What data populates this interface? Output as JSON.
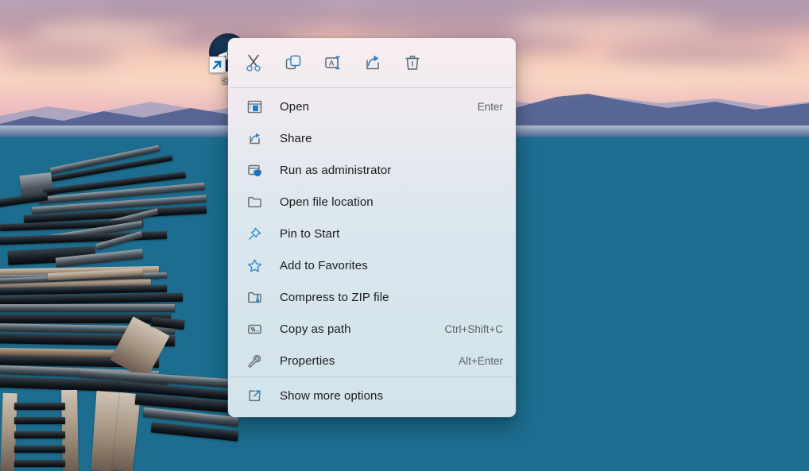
{
  "desktop": {
    "icon": {
      "label": "Ste",
      "full_name": "Steam",
      "art": "steam-disc-icon",
      "overlay": "shortcut-arrow-icon"
    },
    "wallpaper": {
      "description": "sunset lake with wooden pier",
      "sky_color": "#f0c0b4",
      "water_color": "#17749b",
      "mountain_color": "#5a6a93"
    }
  },
  "context_menu": {
    "toolbar": [
      {
        "name": "cut",
        "icon": "scissors-icon",
        "tooltip": "Cut"
      },
      {
        "name": "copy",
        "icon": "copy-icon",
        "tooltip": "Copy"
      },
      {
        "name": "rename",
        "icon": "rename-icon",
        "tooltip": "Rename"
      },
      {
        "name": "share",
        "icon": "share-icon",
        "tooltip": "Share"
      },
      {
        "name": "delete",
        "icon": "trash-icon",
        "tooltip": "Delete"
      }
    ],
    "items_top": [
      {
        "label": "Open",
        "shortcut": "Enter",
        "icon": "open-window-icon"
      },
      {
        "label": "Share",
        "shortcut": "",
        "icon": "share-box-icon"
      },
      {
        "label": "Run as administrator",
        "shortcut": "",
        "icon": "shield-window-icon"
      },
      {
        "label": "Open file location",
        "shortcut": "",
        "icon": "folder-icon"
      },
      {
        "label": "Pin to Start",
        "shortcut": "",
        "icon": "pin-icon"
      },
      {
        "label": "Add to Favorites",
        "shortcut": "",
        "icon": "star-icon"
      },
      {
        "label": "Compress to ZIP file",
        "shortcut": "",
        "icon": "zip-folder-icon"
      },
      {
        "label": "Copy as path",
        "shortcut": "Ctrl+Shift+C",
        "icon": "path-icon"
      },
      {
        "label": "Properties",
        "shortcut": "Alt+Enter",
        "icon": "wrench-icon"
      }
    ],
    "items_bottom": [
      {
        "label": "Show more options",
        "shortcut": "",
        "icon": "more-options-icon"
      }
    ],
    "accent_color": "#0f6cbd",
    "text_color": "#1b1b1b",
    "shortcut_color": "#5d6166"
  }
}
